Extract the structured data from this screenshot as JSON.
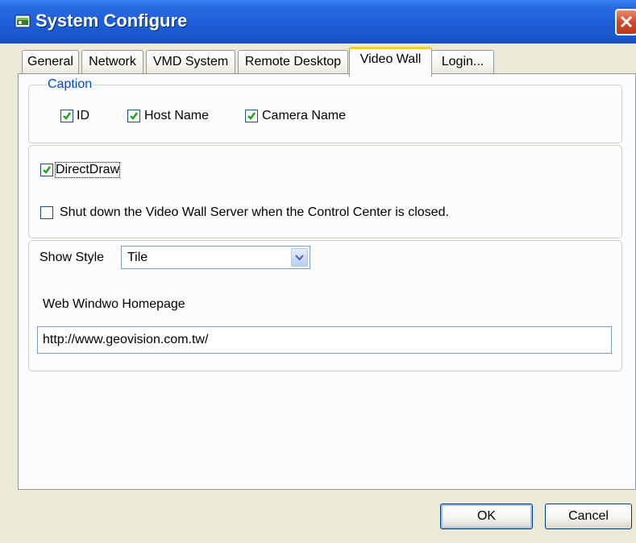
{
  "window": {
    "title": "System Configure"
  },
  "tabs": [
    {
      "label": "General"
    },
    {
      "label": "Network"
    },
    {
      "label": "VMD System"
    },
    {
      "label": "Remote Desktop"
    },
    {
      "label": "Video Wall",
      "active": true
    },
    {
      "label": "Login..."
    }
  ],
  "caption": {
    "legend": "Caption",
    "id_label": "ID",
    "id_checked": true,
    "host_name_label": "Host Name",
    "host_name_checked": true,
    "camera_name_label": "Camera Name",
    "camera_name_checked": true
  },
  "options": {
    "directdraw_label": "DirectDraw",
    "directdraw_checked": true,
    "shutdown_label": "Shut down the Video Wall Server when the Control Center is closed.",
    "shutdown_checked": false
  },
  "show_style": {
    "label": "Show Style",
    "value": "Tile"
  },
  "web_window": {
    "label": "Web Windwo Homepage",
    "value": "http://www.geovision.com.tw/"
  },
  "buttons": {
    "ok_label": "OK",
    "cancel_label": "Cancel"
  },
  "colors": {
    "titlebar": "#1f5fd9",
    "legend_text": "#0046d5",
    "check": "#21a121",
    "close_button": "#d1482b"
  },
  "icons": {
    "app": "app-window-icon",
    "close": "close-icon",
    "check": "checkmark-icon",
    "dropdown": "chevron-down-icon"
  }
}
